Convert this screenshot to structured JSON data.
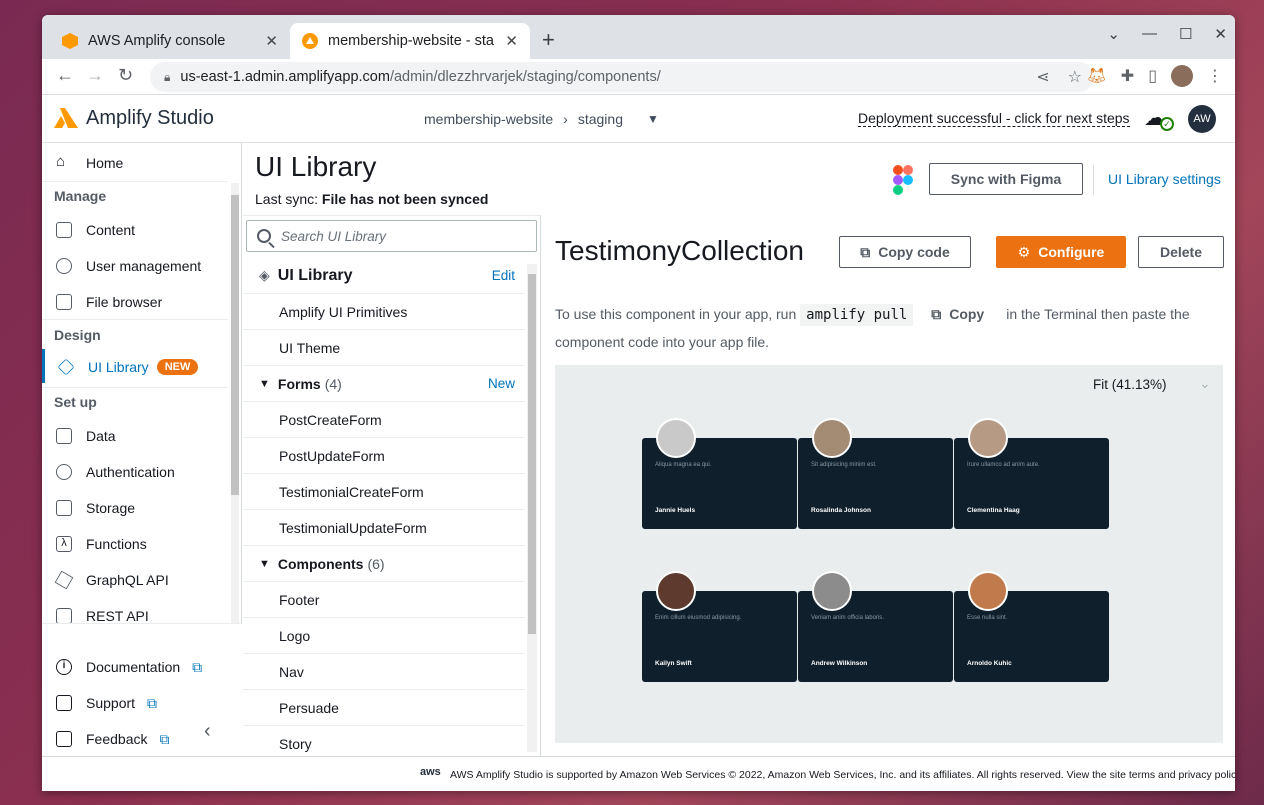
{
  "browser": {
    "tabs": [
      {
        "title": "AWS Amplify console",
        "active": false
      },
      {
        "title": "membership-website - sta",
        "active": true
      }
    ],
    "url": {
      "host": "us-east-1.admin.amplifyapp.com",
      "path": "/admin/dlezzhrvarjek/staging/components/"
    }
  },
  "app": {
    "name": "Amplify Studio",
    "app_name": "membership-website",
    "env": "staging",
    "deploy_status": "Deployment successful - click for next steps",
    "user_initials": "AW"
  },
  "leftnav": {
    "home": "Home",
    "manage_heading": "Manage",
    "manage_items": [
      "Content",
      "User management",
      "File browser"
    ],
    "design_heading": "Design",
    "ui_library": "UI Library",
    "new_badge": "NEW",
    "setup_heading": "Set up",
    "setup_items": [
      "Data",
      "Authentication",
      "Storage",
      "Functions",
      "GraphQL API",
      "REST API"
    ],
    "footer_items": [
      "Documentation",
      "Support",
      "Feedback"
    ]
  },
  "page": {
    "title": "UI Library",
    "last_sync_label": "Last sync:",
    "last_sync_value": "File has not been synced",
    "sync_button": "Sync with Figma",
    "settings_link": "UI Library settings"
  },
  "list": {
    "search_placeholder": "Search UI Library",
    "root_label": "UI Library",
    "edit_label": "Edit",
    "top_items": [
      "Amplify UI Primitives",
      "UI Theme"
    ],
    "forms_label": "Forms",
    "forms_count": "(4)",
    "new_label": "New",
    "forms": [
      "PostCreateForm",
      "PostUpdateForm",
      "TestimonialCreateForm",
      "TestimonialUpdateForm"
    ],
    "components_label": "Components",
    "components_count": "(6)",
    "components": [
      "Footer",
      "Logo",
      "Nav",
      "Persuade",
      "Story"
    ]
  },
  "detail": {
    "title": "TestimonyCollection",
    "copy_code": "Copy code",
    "configure": "Configure",
    "delete": "Delete",
    "instr_pre": "To use this component in your app, run",
    "command": "amplify pull",
    "copy": "Copy",
    "instr_post": "in the Terminal then paste the component code into your app file.",
    "fit": "Fit (41.13%)"
  },
  "cards": [
    {
      "quote": "Aliqua magna ea qui.",
      "name": "Jannie Huels",
      "color": "#c9c9c9"
    },
    {
      "quote": "Sit adipisicing minim est.",
      "name": "Rosalinda Johnson",
      "color": "#a48b74"
    },
    {
      "quote": "Irure ullamco ad anim aute.",
      "name": "Clementina Haag",
      "color": "#b79a84"
    },
    {
      "quote": "Enim cillum eiusmod adipisicing.",
      "name": "Kailyn Swift",
      "color": "#5e3a2e"
    },
    {
      "quote": "Veniam anim officia laboris.",
      "name": "Andrew Wilkinson",
      "color": "#8c8c8c"
    },
    {
      "quote": "Esse nulla sint.",
      "name": "Arnoldo Kuhic",
      "color": "#c07a4c"
    }
  ],
  "footer": {
    "aws": "aws",
    "text": "AWS Amplify Studio is supported by Amazon Web Services © 2022, Amazon Web Services, Inc. and its affiliates. All rights reserved. View the site terms and privacy policy ."
  },
  "colors": {
    "accent": "#ec7211",
    "link": "#0073bb",
    "card_bg": "#0f1f2b"
  }
}
